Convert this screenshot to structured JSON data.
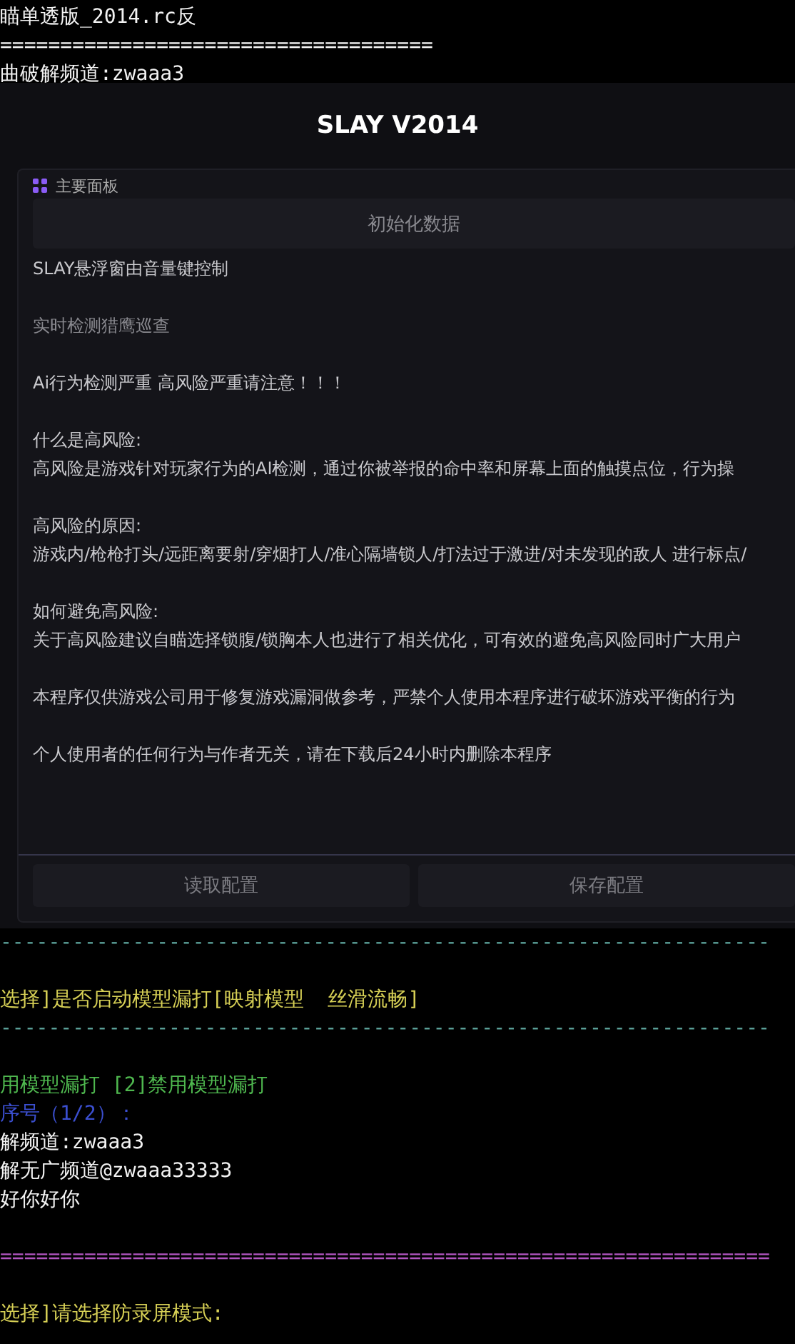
{
  "terminal_top": [
    {
      "kind": "plain",
      "text": "瞄单透版_2014.rc反"
    },
    {
      "kind": "plain",
      "text": "===================================="
    },
    {
      "kind": "plain",
      "text": "曲破解频道:zwaaa3"
    }
  ],
  "window": {
    "title": "SLAY V2014",
    "panel": {
      "title": "主要面板",
      "init_button": "初始化数据",
      "blocks": [
        [
          {
            "kind": "normal",
            "text": "SLAY悬浮窗由音量键控制"
          }
        ],
        [
          {
            "kind": "muted",
            "text": "实时检测猎鹰巡查"
          }
        ],
        [
          {
            "kind": "normal",
            "text": "Ai行为检测严重 高风险严重请注意！！！"
          }
        ],
        [
          {
            "kind": "normal",
            "text": "什么是高风险:"
          },
          {
            "kind": "normal",
            "text": "高风险是游戏针对玩家行为的AI检测，通过你被举报的命中率和屏幕上面的触摸点位，行为操"
          }
        ],
        [
          {
            "kind": "normal",
            "text": "高风险的原因:"
          },
          {
            "kind": "normal",
            "text": "游戏内/枪枪打头/远距离要射/穿烟打人/准心隔墙锁人/打法过于激进/对未发现的敌人 进行标点/"
          }
        ],
        [
          {
            "kind": "normal",
            "text": "如何避免高风险:"
          },
          {
            "kind": "normal",
            "text": "关于高风险建议自瞄选择锁腹/锁胸本人也进行了相关优化，可有效的避免高风险同时广大用户"
          }
        ],
        [
          {
            "kind": "normal",
            "text": "本程序仅供游戏公司用于修复游戏漏洞做参考，严禁个人使用本程序进行破坏游戏平衡的行为"
          }
        ],
        [
          {
            "kind": "normal",
            "text": "个人使用者的任何行为与作者无关，请在下载后24小时内删除本程序"
          }
        ]
      ],
      "buttons": [
        "读取配置",
        "保存配置"
      ]
    }
  },
  "terminal_bottom": [
    {
      "kind": "rule_cyan",
      "text": "----------------------------------------------------------------"
    },
    {
      "kind": "blank"
    },
    {
      "kind": "prompt",
      "text": "选择]是否启动模型漏打[映射模型  丝滑流畅]"
    },
    {
      "kind": "rule_cyan",
      "text": "----------------------------------------------------------------"
    },
    {
      "kind": "blank"
    },
    {
      "kind": "option",
      "text": "用模型漏打 [2]禁用模型漏打"
    },
    {
      "kind": "input",
      "text": "序号（1/2）："
    },
    {
      "kind": "plain",
      "text": "解频道:zwaaa3"
    },
    {
      "kind": "plain",
      "text": "解无广频道@zwaaa33333"
    },
    {
      "kind": "plain",
      "text": "好你好你"
    },
    {
      "kind": "blank"
    },
    {
      "kind": "rule_purple",
      "text": "================================================================"
    },
    {
      "kind": "blank"
    },
    {
      "kind": "prompt",
      "text": "选择]请选择防录屏模式:"
    }
  ]
}
